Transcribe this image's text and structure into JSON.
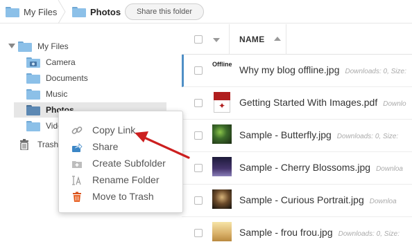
{
  "breadcrumb": {
    "root": "My Files",
    "current": "Photos",
    "share_button": "Share this folder"
  },
  "sidebar": {
    "root_label": "My Files",
    "items": [
      {
        "label": "Camera",
        "icon": "camera-folder-icon"
      },
      {
        "label": "Documents",
        "icon": "folder-icon"
      },
      {
        "label": "Music",
        "icon": "folder-icon"
      },
      {
        "label": "Photos",
        "icon": "folder-icon",
        "selected": true
      },
      {
        "label": "Videos",
        "icon": "folder-icon"
      }
    ],
    "trash_label": "Trash"
  },
  "table": {
    "column_name": "NAME",
    "rows": [
      {
        "name": "Why my blog offline.jpg",
        "meta": "Downloads: 0, Size:",
        "thumb": "offline",
        "thumb_text": "Offline"
      },
      {
        "name": "Getting Started With Images.pdf",
        "meta": "Downlo",
        "thumb": "pdf"
      },
      {
        "name": "Sample - Butterfly.jpg",
        "meta": "Downloads: 0, Size:",
        "thumb": "img1"
      },
      {
        "name": "Sample - Cherry Blossoms.jpg",
        "meta": "Downloa",
        "thumb": "img2"
      },
      {
        "name": "Sample - Curious Portrait.jpg",
        "meta": "Downloa",
        "thumb": "img3"
      },
      {
        "name": "Sample - frou frou.jpg",
        "meta": "Downloads: 0, Size:",
        "thumb": "img4"
      }
    ]
  },
  "context_menu": {
    "items": [
      {
        "label": "Copy Link",
        "icon": "link-icon"
      },
      {
        "label": "Share",
        "icon": "share-icon"
      },
      {
        "label": "Create Subfolder",
        "icon": "new-folder-icon"
      },
      {
        "label": "Rename Folder",
        "icon": "rename-icon"
      },
      {
        "label": "Move to Trash",
        "icon": "trash-icon"
      }
    ]
  },
  "colors": {
    "folder": "#8cc0e8",
    "folder_selected": "#5c88b3",
    "active_row_accent": "#4f8fc6",
    "arrow": "#cc1f1f"
  }
}
